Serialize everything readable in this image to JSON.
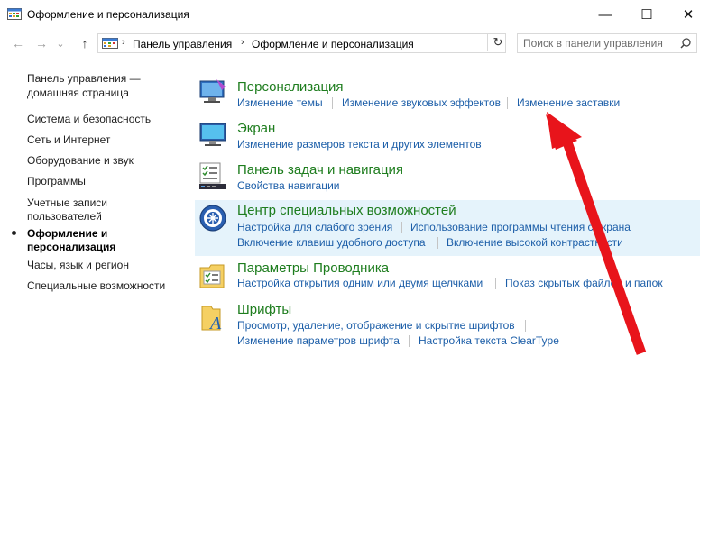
{
  "window": {
    "title": "Оформление и персонализация",
    "minimize_glyph": "—",
    "maximize_glyph": "☐",
    "close_glyph": "✕"
  },
  "address_bar": {
    "back_glyph": "←",
    "forward_glyph": "→",
    "dropdown_glyph": "⌄",
    "up_glyph": "↑",
    "crumbs": [
      "Панель управления",
      "Оформление и персонализация"
    ],
    "sep_glyph": "›",
    "refresh_glyph": "↻"
  },
  "search": {
    "placeholder": "Поиск в панели управления"
  },
  "sidebar": {
    "home_line1": "Панель управления —",
    "home_line2": "домашняя страница",
    "items": [
      "Система и безопасность",
      "Сеть и Интернет",
      "Оборудование и звук",
      "Программы"
    ],
    "accounts_line1": "Учетные записи",
    "accounts_line2": "пользователей",
    "current_line1": "Оформление и",
    "current_line2": "персонализация",
    "items2": [
      "Часы, язык и регион",
      "Специальные возможности"
    ]
  },
  "categories": [
    {
      "title": "Персонализация",
      "icon": "personalization-icon",
      "links": [
        "Изменение темы",
        "Изменение звуковых эффектов",
        "Изменение заставки"
      ]
    },
    {
      "title": "Экран",
      "icon": "display-icon",
      "links": [
        "Изменение размеров текста и других элементов"
      ]
    },
    {
      "title": "Панель задач и навигация",
      "icon": "taskbar-icon",
      "links": [
        "Свойства навигации"
      ]
    },
    {
      "title": "Центр специальных возможностей",
      "icon": "ease-of-access-icon",
      "links": [
        "Настройка для слабого зрения",
        "Использование программы чтения с экрана",
        "Включение клавиш удобного доступа",
        "Включение высокой контрастности"
      ]
    },
    {
      "title": "Параметры Проводника",
      "icon": "explorer-options-icon",
      "links": [
        "Настройка открытия одним или двумя щелчками",
        "Показ скрытых файлов и папок"
      ]
    },
    {
      "title": "Шрифты",
      "icon": "fonts-icon",
      "links": [
        "Просмотр, удаление, отображение и скрытие шрифтов",
        "Изменение параметров шрифта",
        "Настройка текста ClearType"
      ]
    }
  ],
  "colors": {
    "category_title": "#1e7d1e",
    "link": "#1c5ea8",
    "highlight": "#e5f3fb",
    "annotation_arrow": "#e8141b"
  }
}
